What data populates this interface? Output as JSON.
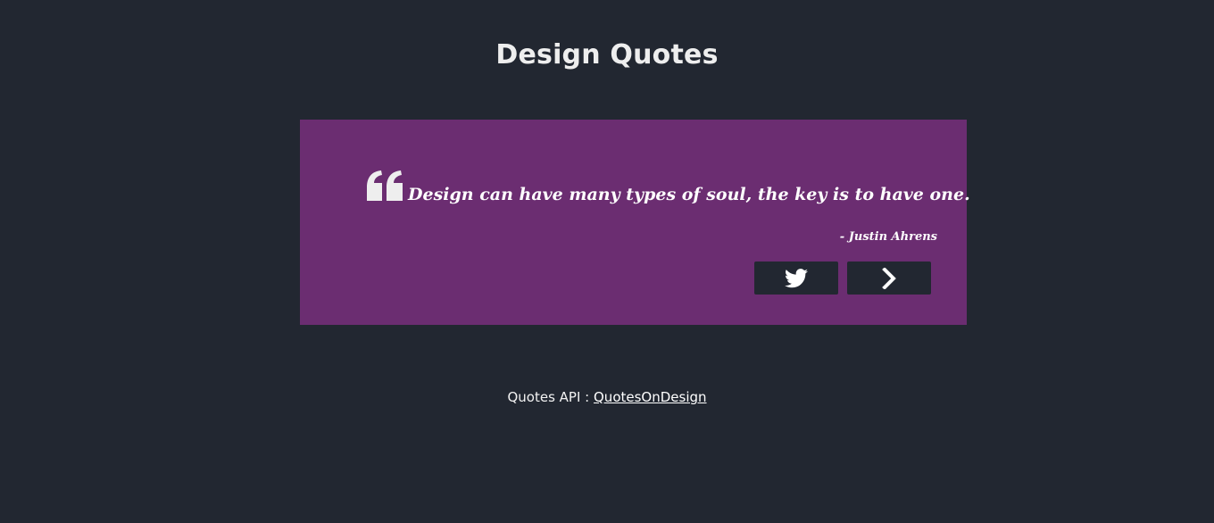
{
  "page": {
    "title": "Design Quotes"
  },
  "quote": {
    "text": "Design can have many types of soul, the key is to have one.",
    "author": "- Justin Ahrens",
    "icon": "quote-left-icon"
  },
  "actions": {
    "tweet_icon": "twitter-icon",
    "next_icon": "chevron-right-icon"
  },
  "footer": {
    "label": "Quotes API :",
    "link_text": "QuotesOnDesign"
  },
  "colors": {
    "background": "#222731",
    "card": "#6b2d71",
    "text": "#ffffff"
  }
}
